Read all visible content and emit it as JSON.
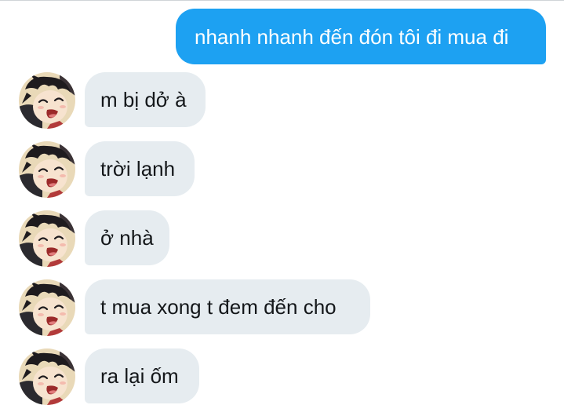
{
  "colors": {
    "outgoing_bubble": "#1da1f2",
    "incoming_bubble": "#e6ecf0",
    "outgoing_text": "#ffffff",
    "incoming_text": "#14171a"
  },
  "messages": [
    {
      "direction": "outgoing",
      "text": "nhanh nhanh đến đón tôi đi mua đi"
    },
    {
      "direction": "incoming",
      "text": "m bị dở à",
      "avatar": "anime-avatar-icon"
    },
    {
      "direction": "incoming",
      "text": "trời lạnh",
      "avatar": "anime-avatar-icon"
    },
    {
      "direction": "incoming",
      "text": "ở nhà",
      "avatar": "anime-avatar-icon"
    },
    {
      "direction": "incoming",
      "text": "t mua xong t đem đến cho",
      "avatar": "anime-avatar-icon"
    },
    {
      "direction": "incoming",
      "text": "ra lại ốm",
      "avatar": "anime-avatar-icon"
    }
  ]
}
